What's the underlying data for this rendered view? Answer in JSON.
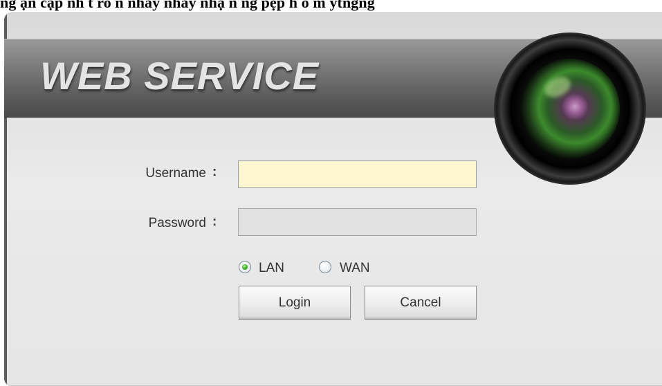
{
  "caption": "ng ạn cập nh t ro n nhấy nhấy nhạ n ng pẹp h o m ytngng",
  "banner": {
    "title": "WEB  SERVICE"
  },
  "form": {
    "username_label": "Username",
    "password_label": "Password",
    "colon": ":",
    "username_value": "",
    "password_value": "",
    "network_options": [
      {
        "label": "LAN",
        "selected": true
      },
      {
        "label": "WAN",
        "selected": false
      }
    ],
    "login_label": "Login",
    "cancel_label": "Cancel"
  },
  "colors": {
    "username_bg": "#fff7cf",
    "password_bg": "#e1e1e1",
    "banner": "#6b6b6b",
    "radio_selected": "#2a9a14"
  },
  "icons": [
    "camera-lens-graphic",
    "radio-selected-icon",
    "radio-unselected-icon"
  ]
}
